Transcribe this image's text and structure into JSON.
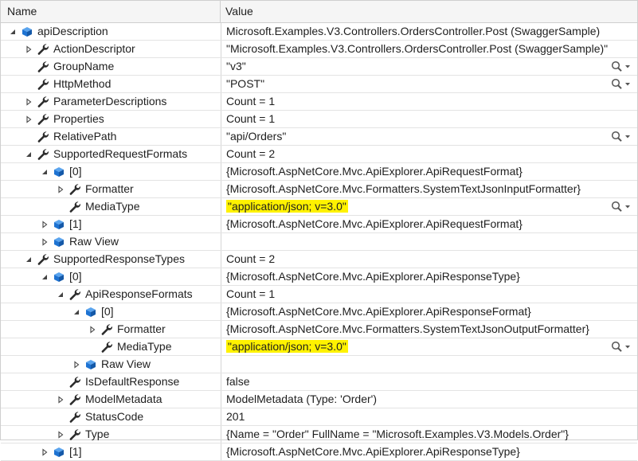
{
  "headers": {
    "name": "Name",
    "value": "Value"
  },
  "rows": [
    {
      "name": "apiDescription",
      "value": "Microsoft.Examples.V3.Controllers.OrdersController.Post (SwaggerSample)",
      "depth": 0,
      "expander": "open",
      "icon": "object-icon",
      "highlight": false,
      "magnifier": false
    },
    {
      "name": "ActionDescriptor",
      "value": "\"Microsoft.Examples.V3.Controllers.OrdersController.Post (SwaggerSample)\"",
      "depth": 1,
      "expander": "closed",
      "icon": "wrench-icon",
      "highlight": false,
      "magnifier": false
    },
    {
      "name": "GroupName",
      "value": "\"v3\"",
      "depth": 1,
      "expander": "none",
      "icon": "wrench-icon",
      "highlight": false,
      "magnifier": true
    },
    {
      "name": "HttpMethod",
      "value": "\"POST\"",
      "depth": 1,
      "expander": "none",
      "icon": "wrench-icon",
      "highlight": false,
      "magnifier": true
    },
    {
      "name": "ParameterDescriptions",
      "value": "Count = 1",
      "depth": 1,
      "expander": "closed",
      "icon": "wrench-icon",
      "highlight": false,
      "magnifier": false
    },
    {
      "name": "Properties",
      "value": "Count = 1",
      "depth": 1,
      "expander": "closed",
      "icon": "wrench-icon",
      "highlight": false,
      "magnifier": false
    },
    {
      "name": "RelativePath",
      "value": "\"api/Orders\"",
      "depth": 1,
      "expander": "none",
      "icon": "wrench-icon",
      "highlight": false,
      "magnifier": true
    },
    {
      "name": "SupportedRequestFormats",
      "value": "Count = 2",
      "depth": 1,
      "expander": "open",
      "icon": "wrench-icon",
      "highlight": false,
      "magnifier": false
    },
    {
      "name": "[0]",
      "value": "{Microsoft.AspNetCore.Mvc.ApiExplorer.ApiRequestFormat}",
      "depth": 2,
      "expander": "open",
      "icon": "object-icon",
      "highlight": false,
      "magnifier": false
    },
    {
      "name": "Formatter",
      "value": "{Microsoft.AspNetCore.Mvc.Formatters.SystemTextJsonInputFormatter}",
      "depth": 3,
      "expander": "closed",
      "icon": "wrench-icon",
      "highlight": false,
      "magnifier": false
    },
    {
      "name": "MediaType",
      "value": "\"application/json; v=3.0\"",
      "depth": 3,
      "expander": "none",
      "icon": "wrench-icon",
      "highlight": true,
      "magnifier": true
    },
    {
      "name": "[1]",
      "value": "{Microsoft.AspNetCore.Mvc.ApiExplorer.ApiRequestFormat}",
      "depth": 2,
      "expander": "closed",
      "icon": "object-icon",
      "highlight": false,
      "magnifier": false
    },
    {
      "name": "Raw View",
      "value": "",
      "depth": 2,
      "expander": "closed",
      "icon": "object-icon",
      "highlight": false,
      "magnifier": false
    },
    {
      "name": "SupportedResponseTypes",
      "value": "Count = 2",
      "depth": 1,
      "expander": "open",
      "icon": "wrench-icon",
      "highlight": false,
      "magnifier": false
    },
    {
      "name": "[0]",
      "value": "{Microsoft.AspNetCore.Mvc.ApiExplorer.ApiResponseType}",
      "depth": 2,
      "expander": "open",
      "icon": "object-icon",
      "highlight": false,
      "magnifier": false
    },
    {
      "name": "ApiResponseFormats",
      "value": "Count = 1",
      "depth": 3,
      "expander": "open",
      "icon": "wrench-icon",
      "highlight": false,
      "magnifier": false
    },
    {
      "name": "[0]",
      "value": "{Microsoft.AspNetCore.Mvc.ApiExplorer.ApiResponseFormat}",
      "depth": 4,
      "expander": "open",
      "icon": "object-icon",
      "highlight": false,
      "magnifier": false
    },
    {
      "name": "Formatter",
      "value": "{Microsoft.AspNetCore.Mvc.Formatters.SystemTextJsonOutputFormatter}",
      "depth": 5,
      "expander": "closed",
      "icon": "wrench-icon",
      "highlight": false,
      "magnifier": false
    },
    {
      "name": "MediaType",
      "value": "\"application/json; v=3.0\"",
      "depth": 5,
      "expander": "none",
      "icon": "wrench-icon",
      "highlight": true,
      "magnifier": true
    },
    {
      "name": "Raw View",
      "value": "",
      "depth": 4,
      "expander": "closed",
      "icon": "object-icon",
      "highlight": false,
      "magnifier": false
    },
    {
      "name": "IsDefaultResponse",
      "value": "false",
      "depth": 3,
      "expander": "none",
      "icon": "wrench-icon",
      "highlight": false,
      "magnifier": false
    },
    {
      "name": "ModelMetadata",
      "value": "ModelMetadata (Type: 'Order')",
      "depth": 3,
      "expander": "closed",
      "icon": "wrench-icon",
      "highlight": false,
      "magnifier": false
    },
    {
      "name": "StatusCode",
      "value": "201",
      "depth": 3,
      "expander": "none",
      "icon": "wrench-icon",
      "highlight": false,
      "magnifier": false
    },
    {
      "name": "Type",
      "value": "{Name = \"Order\" FullName = \"Microsoft.Examples.V3.Models.Order\"}",
      "depth": 3,
      "expander": "closed",
      "icon": "wrench-icon",
      "highlight": false,
      "magnifier": false
    },
    {
      "name": "[1]",
      "value": "{Microsoft.AspNetCore.Mvc.ApiExplorer.ApiResponseType}",
      "depth": 2,
      "expander": "closed",
      "icon": "object-icon",
      "highlight": false,
      "magnifier": false
    }
  ],
  "colors": {
    "object": "#1e73d2",
    "wrench": "#2b2b2b",
    "highlight": "#fff200",
    "expander": "#444444"
  }
}
